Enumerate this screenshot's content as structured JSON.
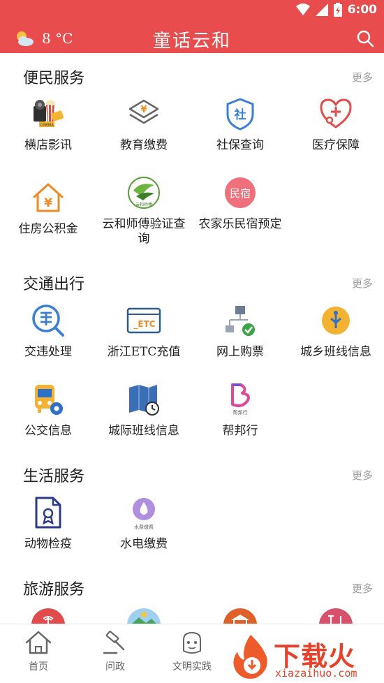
{
  "status": {
    "time": "6:00"
  },
  "header": {
    "temperature": "8 °C",
    "brand": "童话云和"
  },
  "sections": [
    {
      "title": "便民服务",
      "more": "更多",
      "items": [
        "横店影讯",
        "教育缴费",
        "社保查询",
        "医疗保障",
        "住房公积金",
        "云和师傅验证查询",
        "农家乐民宿预定"
      ]
    },
    {
      "title": "交通出行",
      "more": "更多",
      "items": [
        "交违处理",
        "浙江ETC充值",
        "网上购票",
        "城乡班线信息",
        "公交信息",
        "城际班线信息",
        "帮邦行"
      ]
    },
    {
      "title": "生活服务",
      "more": "更多",
      "items": [
        "动物检疫",
        "水电缴费"
      ]
    },
    {
      "title": "旅游服务",
      "more": "更多",
      "items": []
    }
  ],
  "icon_text": {
    "education": "¥",
    "social": "社",
    "housing": "¥",
    "etc": "_ETC",
    "minsu": "民宿",
    "water_caption": "水费缴费",
    "bangbang_caption": "帮邦行",
    "shifu_logo": "云和师傅",
    "ticket_text": "CINEMA"
  },
  "tabs": [
    "首页",
    "问政",
    "文明实践"
  ],
  "watermark": {
    "text": "下载火",
    "url": "xiazaihuo.com"
  },
  "colors": {
    "primary": "#e84c4c",
    "blue": "#3b7fd4",
    "orange": "#f08a24",
    "red": "#e24b4b",
    "green": "#3aa546"
  }
}
